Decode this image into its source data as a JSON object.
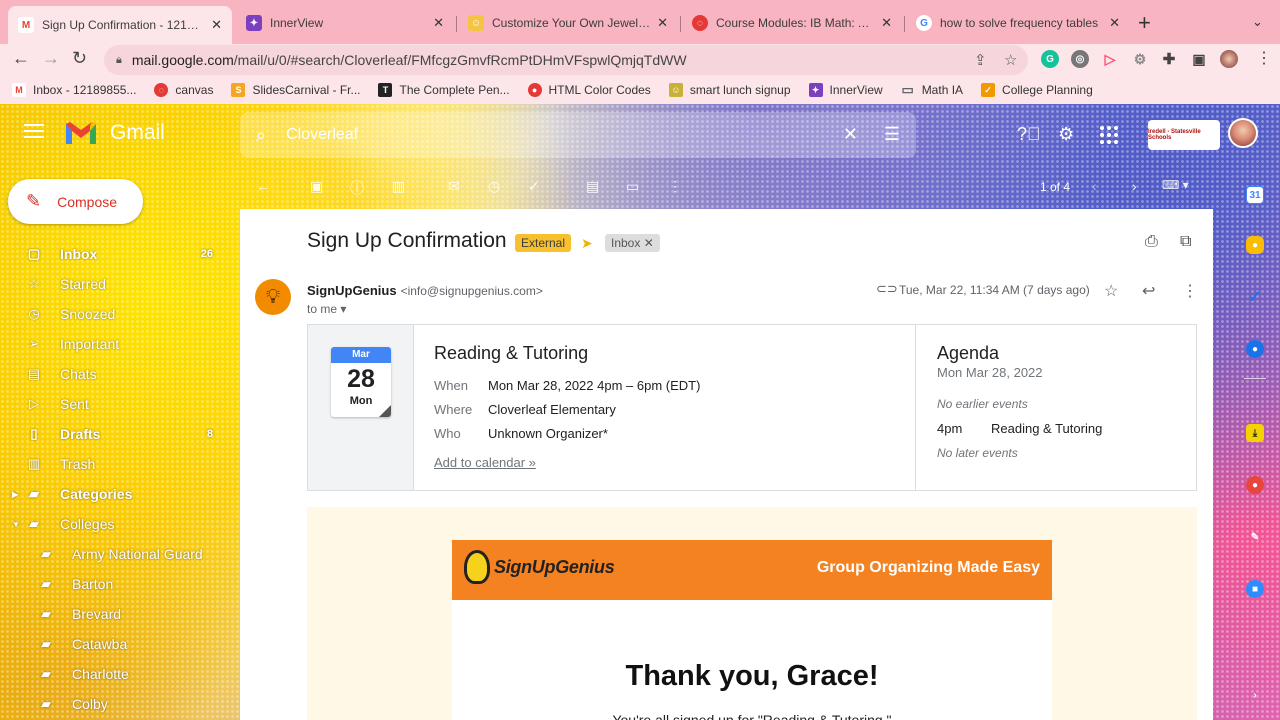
{
  "browser": {
    "tabs": [
      {
        "title": "Sign Up Confirmation - 121898",
        "favicon_color": "#ea4335",
        "favicon_glyph": "M",
        "active": true
      },
      {
        "title": "InnerView",
        "favicon_color": "#7b3fc0",
        "favicon_glyph": "✦",
        "active": false
      },
      {
        "title": "Customize Your Own Jewelry, E",
        "favicon_color": "#f4c542",
        "favicon_glyph": "☺",
        "active": false
      },
      {
        "title": "Course Modules: IB Math: Ana",
        "favicon_color": "#e53935",
        "favicon_glyph": "◌",
        "active": false
      },
      {
        "title": "how to solve frequency tables",
        "favicon_color": "#4285f4",
        "favicon_glyph": "G",
        "active": false
      }
    ],
    "url_host": "mail.google.com",
    "url_path": "/mail/u/0/#search/Cloverleaf/FMfcgzGmvfRcmPtDHmVFspwlQmjqTdWW",
    "bookmarks": [
      {
        "label": "Inbox - 12189855...",
        "color": "#ea4335",
        "glyph": "M"
      },
      {
        "label": "canvas",
        "color": "#e53935",
        "glyph": "◌"
      },
      {
        "label": "SlidesCarnival - Fr...",
        "color": "#f5a623",
        "glyph": "S"
      },
      {
        "label": "The Complete Pen...",
        "color": "#222222",
        "glyph": "T"
      },
      {
        "label": "HTML Color Codes",
        "color": "#e53935",
        "glyph": "●"
      },
      {
        "label": "smart lunch signup",
        "color": "#c9b037",
        "glyph": "☺"
      },
      {
        "label": "InnerView",
        "color": "#7b3fc0",
        "glyph": "✦"
      },
      {
        "label": "Math IA",
        "color": "#5f6368",
        "glyph": "▭"
      },
      {
        "label": "College Planning",
        "color": "#f29900",
        "glyph": "✓"
      }
    ]
  },
  "gmail": {
    "brand": "Gmail",
    "search_value": "Cloverleaf",
    "compose_label": "Compose",
    "nav": [
      {
        "label": "Inbox",
        "icon": "inbox-icon",
        "glyph": "▢",
        "count": "26",
        "bold": true
      },
      {
        "label": "Starred",
        "icon": "star-icon",
        "glyph": "☆",
        "count": "",
        "bold": false
      },
      {
        "label": "Snoozed",
        "icon": "clock-icon",
        "glyph": "◷",
        "count": "",
        "bold": false
      },
      {
        "label": "Important",
        "icon": "important-icon",
        "glyph": "➢",
        "count": "",
        "bold": false
      },
      {
        "label": "Chats",
        "icon": "chat-icon",
        "glyph": "▤",
        "count": "",
        "bold": false
      },
      {
        "label": "Sent",
        "icon": "send-icon",
        "glyph": "▷",
        "count": "",
        "bold": false
      },
      {
        "label": "Drafts",
        "icon": "draft-icon",
        "glyph": "▯",
        "count": "8",
        "bold": true
      },
      {
        "label": "Trash",
        "icon": "trash-icon",
        "glyph": "▥",
        "count": "",
        "bold": false
      },
      {
        "label": "Categories",
        "icon": "label-icon",
        "glyph": "▰",
        "count": "",
        "bold": true,
        "arrow": "▶"
      },
      {
        "label": "Colleges",
        "icon": "label-icon",
        "glyph": "▰",
        "count": "",
        "bold": false,
        "arrow": "▼"
      },
      {
        "label": "Army National Guard",
        "icon": "label-icon",
        "glyph": "▰",
        "count": "",
        "bold": false,
        "sub": true
      },
      {
        "label": "Barton",
        "icon": "label-icon",
        "glyph": "▰",
        "count": "",
        "bold": false,
        "sub": true
      },
      {
        "label": "Brevard",
        "icon": "label-icon",
        "glyph": "▰",
        "count": "",
        "bold": false,
        "sub": true
      },
      {
        "label": "Catawba",
        "icon": "label-icon",
        "glyph": "▰",
        "count": "",
        "bold": false,
        "sub": true
      },
      {
        "label": "Charlotte",
        "icon": "label-icon",
        "glyph": "▰",
        "count": "",
        "bold": false,
        "sub": true
      },
      {
        "label": "Colby",
        "icon": "label-icon",
        "glyph": "▰",
        "count": "",
        "bold": false,
        "sub": true
      }
    ],
    "pager": "1 of 4",
    "org_badge": "Iredell - Statesville Schools"
  },
  "message": {
    "subject": "Sign Up Confirmation",
    "label_external": "External",
    "label_inbox": "Inbox",
    "sender_name": "SignUpGenius",
    "sender_email": "<info@signupgenius.com>",
    "to": "to me",
    "date": "Tue, Mar 22, 11:34 AM (7 days ago)"
  },
  "invite": {
    "month": "Mar",
    "day": "28",
    "weekday": "Mon",
    "title": "Reading & Tutoring",
    "when_label": "When",
    "when": "Mon Mar 28, 2022 4pm – 6pm (EDT)",
    "where_label": "Where",
    "where": "Cloverleaf Elementary",
    "who_label": "Who",
    "who": "Unknown Organizer*",
    "add_link": "Add to calendar »",
    "agenda_title": "Agenda",
    "agenda_date": "Mon Mar 28, 2022",
    "no_earlier": "No earlier events",
    "event_time": "4pm",
    "event_name": "Reading & Tutoring",
    "no_later": "No later events"
  },
  "email_body": {
    "brand": "SignUpGenius",
    "tagline": "Group Organizing Made Easy",
    "thanks": "Thank you, Grace!",
    "signed_up": "You're all signed up for \"Reading & Tutoring.\""
  },
  "colors": {
    "compose_red": "#d93025",
    "external_tag": "#f7c02e",
    "sug_orange": "#f58220",
    "tab_bar": "#f9b4c1"
  }
}
